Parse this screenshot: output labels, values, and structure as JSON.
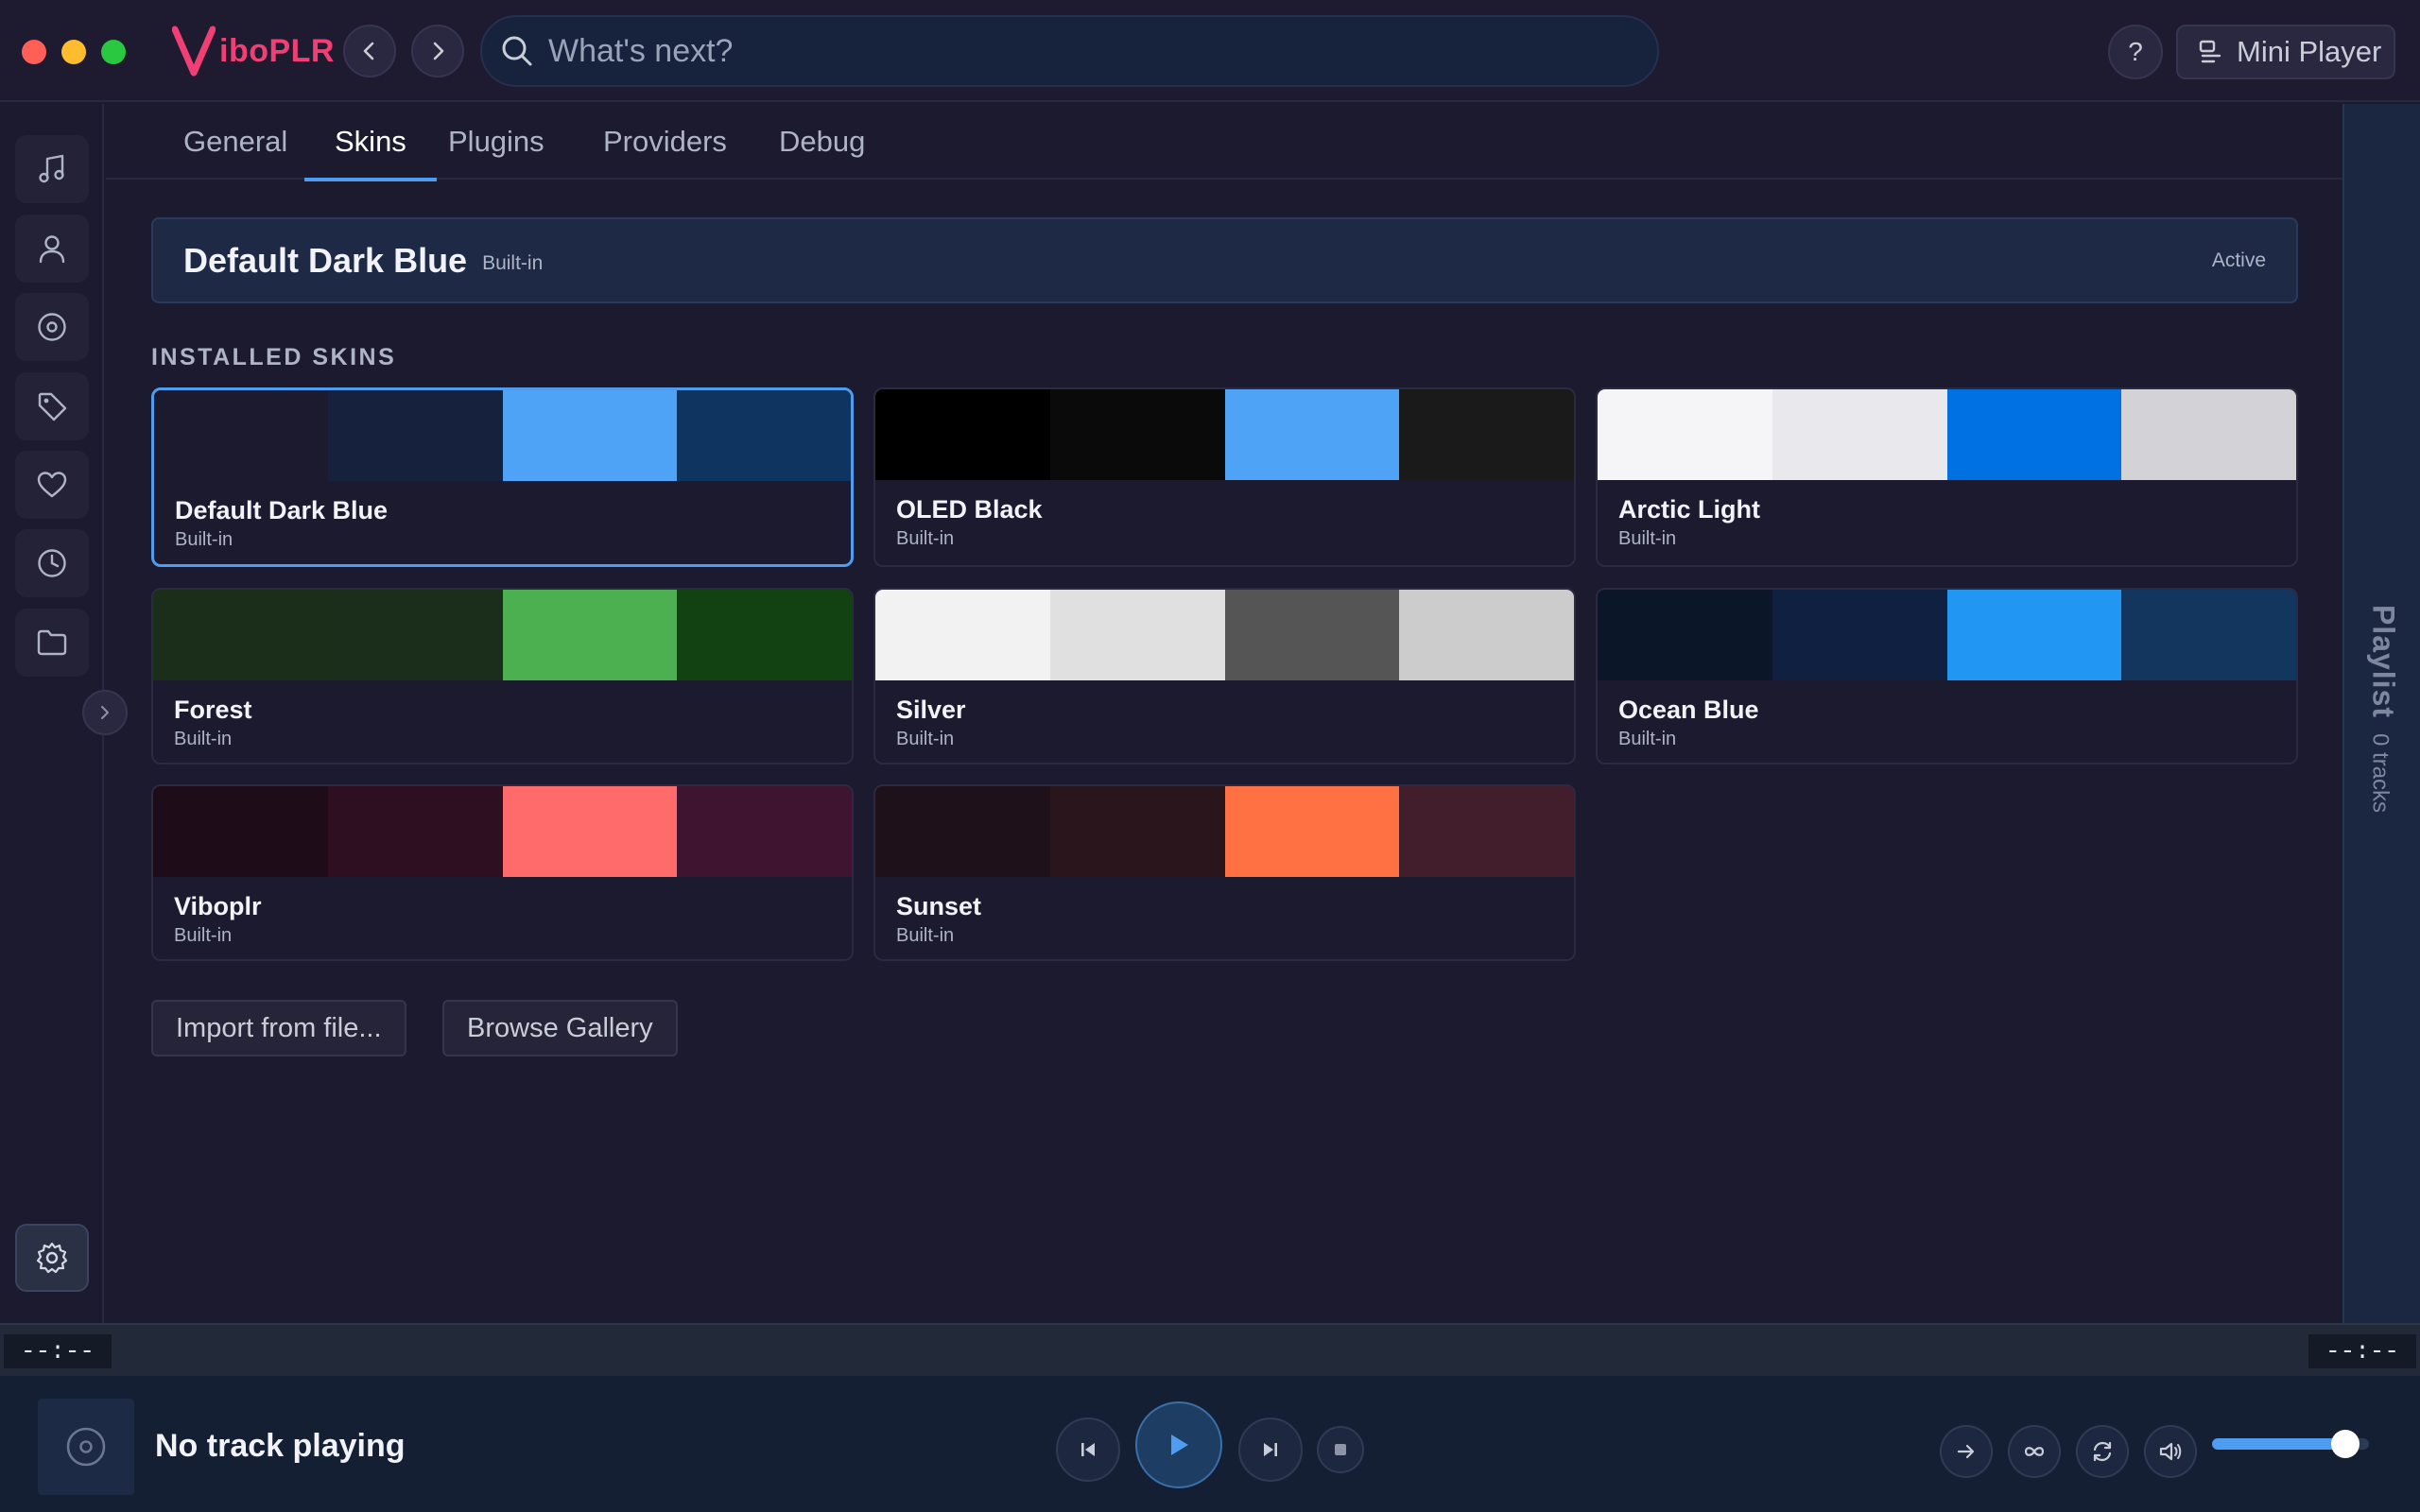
{
  "app": {
    "brand": "iboPLR"
  },
  "search": {
    "placeholder": "What's next?"
  },
  "header": {
    "help_label": "?",
    "mini_player_label": "Mini Player"
  },
  "tabs": [
    {
      "label": "General",
      "active": false
    },
    {
      "label": "Skins",
      "active": true
    },
    {
      "label": "Plugins",
      "active": false
    },
    {
      "label": "Providers",
      "active": false
    },
    {
      "label": "Debug",
      "active": false
    }
  ],
  "sidebar": {
    "items": [
      {
        "icon": "music-note-icon"
      },
      {
        "icon": "person-icon"
      },
      {
        "icon": "disc-icon"
      },
      {
        "icon": "tag-icon"
      },
      {
        "icon": "heart-icon"
      },
      {
        "icon": "clock-icon"
      },
      {
        "icon": "folder-icon"
      }
    ],
    "settings_icon": "gear-icon"
  },
  "active_skin": {
    "name": "Default Dark Blue",
    "tag": "Built-in",
    "status": "Active"
  },
  "installed": {
    "heading": "INSTALLED SKINS",
    "skins": [
      {
        "name": "Default Dark Blue",
        "tag": "Built-in",
        "colors": [
          "#1c1a2e",
          "#16213e",
          "#4fa3f7",
          "#0f3460"
        ],
        "selected": true
      },
      {
        "name": "OLED Black",
        "tag": "Built-in",
        "colors": [
          "#000000",
          "#0a0a0a",
          "#4fa3f7",
          "#1a1a1a"
        ],
        "selected": false
      },
      {
        "name": "Arctic Light",
        "tag": "Built-in",
        "colors": [
          "#f5f5f7",
          "#e8e8ed",
          "#0071e3",
          "#d2d2d7"
        ],
        "selected": false
      },
      {
        "name": "Forest",
        "tag": "Built-in",
        "colors": [
          "#1a2e1a",
          "#1b2d1b",
          "#4caf50",
          "#124112"
        ],
        "selected": false
      },
      {
        "name": "Silver",
        "tag": "Built-in",
        "colors": [
          "#f2f2f2",
          "#e0e0e0",
          "#555555",
          "#cccccc"
        ],
        "selected": false
      },
      {
        "name": "Ocean Blue",
        "tag": "Built-in",
        "colors": [
          "#0b1628",
          "#0f2040",
          "#2196f3",
          "#13365f"
        ],
        "selected": false
      },
      {
        "name": "Viboplr",
        "tag": "Built-in",
        "colors": [
          "#1e0d19",
          "#2d0f21",
          "#ff6b6b",
          "#3e1430"
        ],
        "selected": false
      },
      {
        "name": "Sunset",
        "tag": "Built-in",
        "colors": [
          "#1f1119",
          "#2b151d",
          "#ff7043",
          "#421e2c"
        ],
        "selected": false
      }
    ]
  },
  "actions": {
    "import_label": "Import from file...",
    "gallery_label": "Browse Gallery"
  },
  "playlist": {
    "title": "Playlist",
    "count": "0 tracks"
  },
  "player": {
    "elapsed": "--:--",
    "remaining": "--:--",
    "now_playing": "No track playing",
    "volume_fraction": 0.85
  },
  "colors": {
    "accent": "#4f9df0",
    "brand": "#ef3f74"
  }
}
